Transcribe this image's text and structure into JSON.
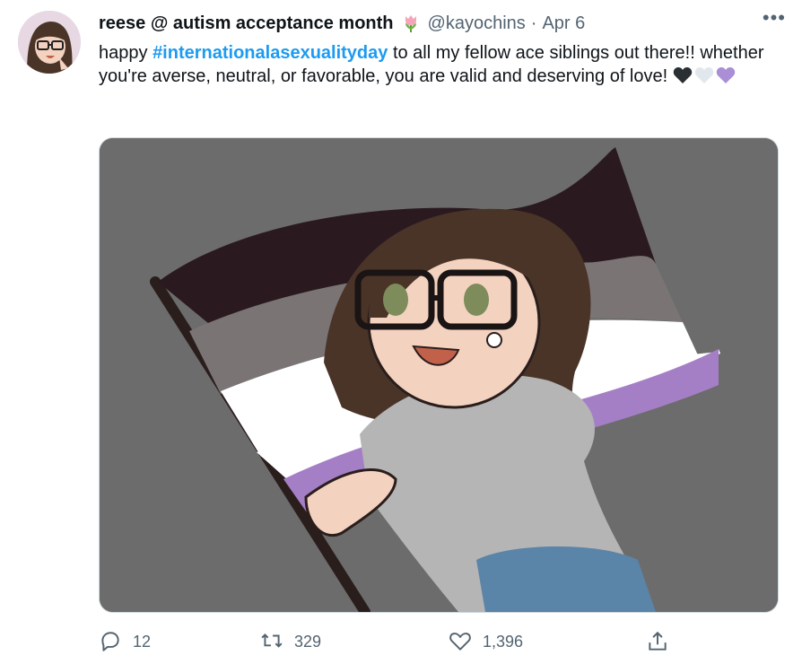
{
  "tweet": {
    "display_name": "reese @ autism acceptance month",
    "handle": "@kayochins",
    "separator": "·",
    "date": "Apr 6",
    "more_label": "•••",
    "text_before_hashtag": "happy ",
    "hashtag": "#internationalasexualityday",
    "text_after_hashtag": " to all my fellow ace siblings out there!! whether you're averse, neutral, or favorable, you are valid and deserving of love!",
    "heart_colors": [
      "#292f33",
      "#e1e8ed",
      "#aa8ed6"
    ]
  },
  "actions": {
    "reply_count": "12",
    "retweet_count": "329",
    "like_count": "1,396"
  },
  "colors": {
    "accent": "#1d9bf0",
    "ace_flag": [
      "#2a1a1f",
      "#7a7475",
      "#ffffff",
      "#a57fc6"
    ]
  }
}
